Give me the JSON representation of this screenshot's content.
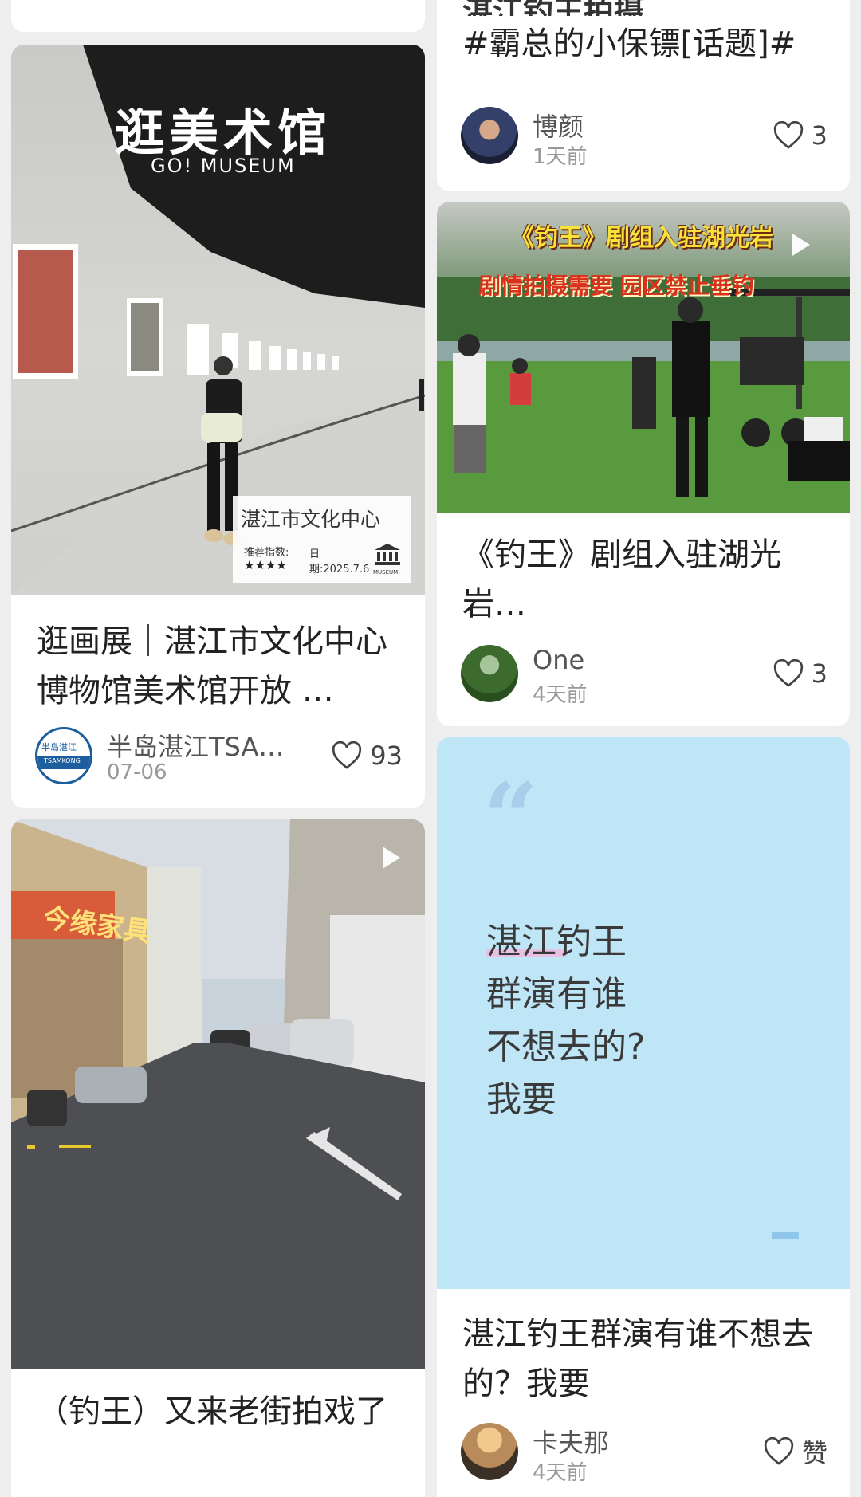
{
  "feed": {
    "left_top_stub": {},
    "right_top": {
      "title_partial": "湛江钓王拍摄",
      "title": "#霸总的小保镖[话题]#",
      "author": "博颜",
      "time": "1天前",
      "likes": "3"
    },
    "museum": {
      "overlay_title": "逛美术馆",
      "overlay_subtitle": "GO! MUSEUM",
      "badge_place": "湛江市文化中心",
      "badge_rec_label": "推荐指数:",
      "badge_stars": "★★★★",
      "badge_date": "日期:2025.7.6",
      "badge_icon_label": "MUSEUM",
      "title": "逛画展｜湛江市文化中心博物馆美术馆开放 …",
      "author": "半岛湛江TSA…",
      "avatar_text_top": "半岛湛江",
      "avatar_text_bottom": "TSAMKONG",
      "time": "07-06",
      "likes": "93"
    },
    "diaowang": {
      "banner_line1": "《钓王》剧组入驻湖光岩",
      "banner_line2": "剧情拍摄需要 园区禁止垂钓",
      "title": "《钓王》剧组入驻湖光岩…",
      "author": "One",
      "time": "4天前",
      "likes": "3"
    },
    "street": {
      "shop_sign": "今缘家具",
      "title": "（钓王）又来老街拍戏了"
    },
    "quote": {
      "quote_mark": "“",
      "lines": [
        "湛江钓王",
        "群演有谁",
        "不想去的?",
        "我要"
      ],
      "title": "湛江钓王群演有谁不想去的？我要",
      "author": "卡夫那",
      "time": "4天前",
      "likes": "赞"
    }
  },
  "colors": {
    "background": "#eeeeee",
    "card": "#ffffff",
    "quote_bg": "#bfe6f6",
    "quote_mark": "#a9cdea",
    "highlight": "#f3b6e0"
  }
}
